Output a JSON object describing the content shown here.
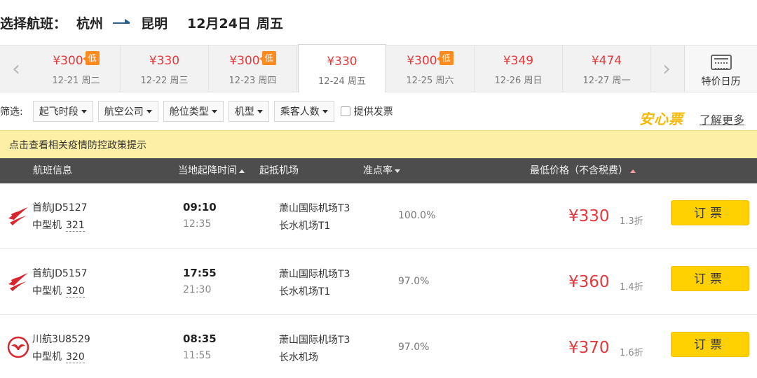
{
  "header": {
    "label": "选择航班：",
    "from": "杭州",
    "to": "昆明",
    "date": "12月24日",
    "weekday": "周五"
  },
  "date_strip": {
    "dates": [
      {
        "price": "¥300",
        "day": "12-21 周二",
        "low": true
      },
      {
        "price": "¥330",
        "day": "12-22 周三",
        "low": false
      },
      {
        "price": "¥300",
        "day": "12-23 周四",
        "low": true
      },
      {
        "price": "¥330",
        "day": "12-24 周五",
        "low": false,
        "active": true
      },
      {
        "price": "¥300",
        "day": "12-25 周六",
        "low": true
      },
      {
        "price": "¥349",
        "day": "12-26 周日",
        "low": false
      },
      {
        "price": "¥474",
        "day": "12-27 周一",
        "low": false
      }
    ],
    "low_badge": "低",
    "calendar_label": "特价日历",
    "prev_icon": "chevron-left-icon",
    "next_icon": "chevron-right-icon"
  },
  "filters": {
    "label": "筛选:",
    "dropdowns": [
      "起飞时段",
      "航空公司",
      "舱位类型",
      "机型",
      "乘客人数"
    ],
    "checkbox_label": "提供发票",
    "promo": "安心票",
    "learn_more": "了解更多"
  },
  "notice": "点击查看相关疫情防控政策提示",
  "table_header": {
    "flight_info": "航班信息",
    "time": "当地起降时间",
    "airport": "起抵机场",
    "ontime": "准点率",
    "price": "最低价格（不含税费）"
  },
  "flights": [
    {
      "airline": "首航JD5127",
      "aircraft": "中型机",
      "code": "321",
      "dep": "09:10",
      "arr": "12:35",
      "dep_airport": "萧山国际机场T3",
      "arr_airport": "长水机场T1",
      "ontime": "100.0%",
      "price": "¥330",
      "discount": "1.3折",
      "book": "订票",
      "logo": "capital-airlines-logo"
    },
    {
      "airline": "首航JD5157",
      "aircraft": "中型机",
      "code": "320",
      "dep": "17:55",
      "arr": "21:30",
      "dep_airport": "萧山国际机场T3",
      "arr_airport": "长水机场T1",
      "ontime": "97.0%",
      "price": "¥360",
      "discount": "1.4折",
      "book": "订票",
      "logo": "capital-airlines-logo"
    },
    {
      "airline": "川航3U8529",
      "aircraft": "中型机",
      "code": "320",
      "dep": "08:35",
      "arr": "11:55",
      "dep_airport": "萧山国际机场T3",
      "arr_airport": "长水机场",
      "ontime": "97.0%",
      "price": "¥370",
      "discount": "1.6折",
      "book": "订票",
      "logo": "sichuan-airlines-logo"
    }
  ],
  "colors": {
    "price_red": "#e4393c",
    "book_yellow": "#ffd100",
    "notice_bg": "#fdf0a6",
    "header_dark": "#4d4d4d",
    "promo_yellow": "#f6b800",
    "badge_orange": "#ff8a1e"
  }
}
